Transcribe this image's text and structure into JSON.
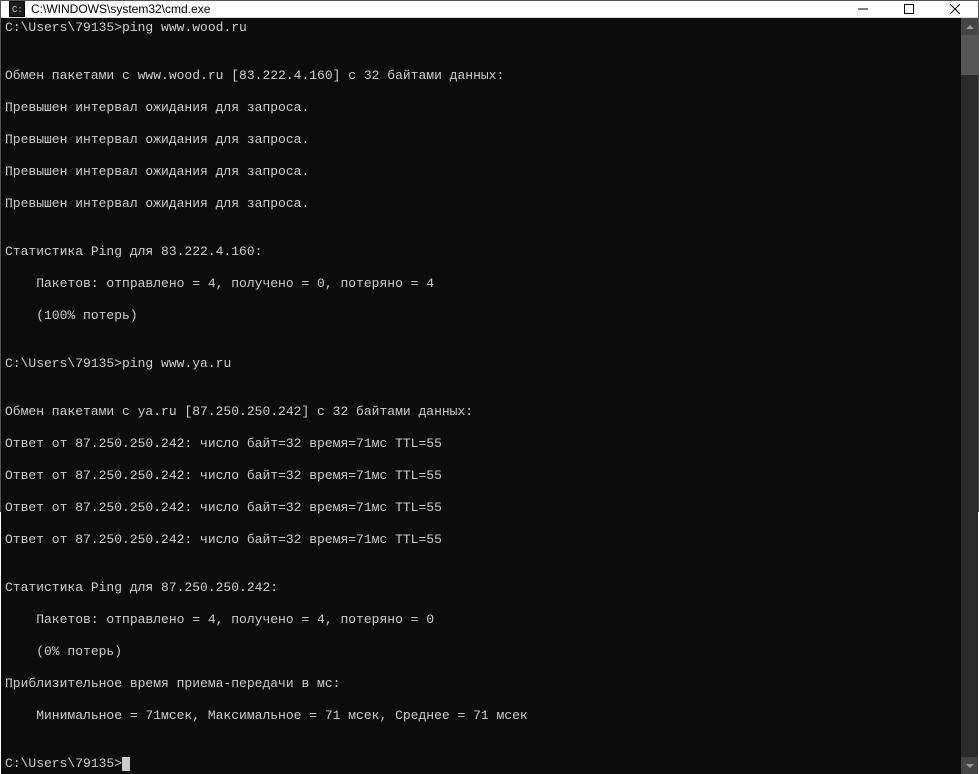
{
  "window": {
    "title": "C:\\WINDOWS\\system32\\cmd.exe",
    "icon": "cmd-icon"
  },
  "controls": {
    "minimize": "—",
    "maximize": "☐",
    "close": "✕"
  },
  "terminal": {
    "prompt1": "C:\\Users\\79135>",
    "command1": "ping www.wood.ru",
    "blank": "",
    "wood_header": "Обмен пакетами с www.wood.ru [83.222.4.160] с 32 байтами данных:",
    "wood_reply1": "Превышен интервал ожидания для запроса.",
    "wood_reply2": "Превышен интервал ожидания для запроса.",
    "wood_reply3": "Превышен интервал ожидания для запроса.",
    "wood_reply4": "Превышен интервал ожидания для запроса.",
    "wood_stats_header": "Статистика Ping для 83.222.4.160:",
    "wood_stats_packets": "    Пакетов: отправлено = 4, получено = 0, потеряно = 4",
    "wood_stats_loss": "    (100% потерь)",
    "prompt2": "C:\\Users\\79135>",
    "command2": "ping www.ya.ru",
    "ya_header": "Обмен пакетами с ya.ru [87.250.250.242] с 32 байтами данных:",
    "ya_reply1": "Ответ от 87.250.250.242: число байт=32 время=71мс TTL=55",
    "ya_reply2": "Ответ от 87.250.250.242: число байт=32 время=71мс TTL=55",
    "ya_reply3": "Ответ от 87.250.250.242: число байт=32 время=71мс TTL=55",
    "ya_reply4": "Ответ от 87.250.250.242: число байт=32 время=71мс TTL=55",
    "ya_stats_header": "Статистика Ping для 87.250.250.242:",
    "ya_stats_packets": "    Пакетов: отправлено = 4, получено = 4, потеряно = 0",
    "ya_stats_loss": "    (0% потерь)",
    "ya_rtt_header": "Приблизительное время приема-передачи в мс:",
    "ya_rtt_values": "    Минимальное = 71мсек, Максимальное = 71 мсек, Среднее = 71 мсек",
    "prompt3": "C:\\Users\\79135>"
  }
}
